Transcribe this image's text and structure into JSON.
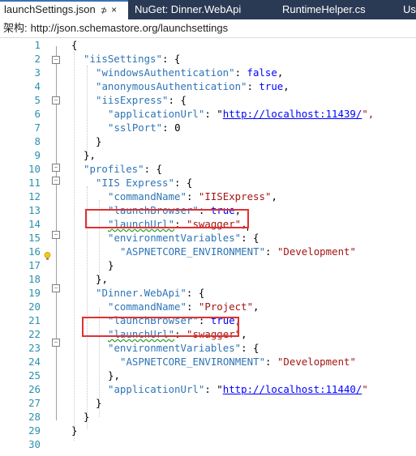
{
  "tabs": [
    {
      "label": "launchSettings.json",
      "pin": "⊅",
      "close": "×",
      "active": true
    },
    {
      "label": "NuGet: Dinner.WebApi",
      "active": false
    },
    {
      "label": "RuntimeHelper.cs",
      "active": false
    },
    {
      "label": "Us",
      "active": false
    }
  ],
  "schema": {
    "label": "架构:",
    "url": "http://json.schemastore.org/launchsettings"
  },
  "line_numbers": [
    "1",
    "2",
    "3",
    "4",
    "5",
    "6",
    "7",
    "8",
    "9",
    "10",
    "11",
    "12",
    "13",
    "14",
    "15",
    "16",
    "17",
    "18",
    "19",
    "20",
    "21",
    "22",
    "23",
    "24",
    "25",
    "26",
    "27",
    "28",
    "29",
    "30"
  ],
  "code": {
    "l1": "{",
    "l2_k": "\"iisSettings\"",
    "l2_p": ": {",
    "l3_k": "\"windowsAuthentication\"",
    "l3_p": ": ",
    "l3_v": "false",
    "l3_e": ",",
    "l4_k": "\"anonymousAuthentication\"",
    "l4_p": ": ",
    "l4_v": "true",
    "l4_e": ",",
    "l5_k": "\"iisExpress\"",
    "l5_p": ": {",
    "l6_k": "\"applicationUrl\"",
    "l6_p": ": \"",
    "l6_v": "http://localhost:11439/",
    "l6_e": "\",",
    "l7_k": "\"sslPort\"",
    "l7_p": ": ",
    "l7_v": "0",
    "l8": "}",
    "l9": "},",
    "l10_k": "\"profiles\"",
    "l10_p": ": {",
    "l11_k": "\"IIS Express\"",
    "l11_p": ": {",
    "l12_k": "\"commandName\"",
    "l12_p": ": ",
    "l12_v": "\"IISExpress\"",
    "l12_e": ",",
    "l13_k": "\"launchBrowser\"",
    "l13_p": ": ",
    "l13_v": "true",
    "l13_e": ",",
    "l14_k": "\"launchUrl\"",
    "l14_p": ": ",
    "l14_v": "\"swagger\"",
    "l14_e": ",",
    "l15_k": "\"environmentVariables\"",
    "l15_p": ": {",
    "l16_k": "\"ASPNETCORE_ENVIRONMENT\"",
    "l16_p": ": ",
    "l16_v": "\"Development\"",
    "l17": "}",
    "l18": "},",
    "l19_k": "\"Dinner.WebApi\"",
    "l19_p": ": {",
    "l20_k": "\"commandName\"",
    "l20_p": ": ",
    "l20_v": "\"Project\"",
    "l20_e": ",",
    "l21_k": "\"launchBrowser\"",
    "l21_p": ": ",
    "l21_v": "true",
    "l21_e": ",",
    "l22_k": "\"launchUrl\"",
    "l22_p": ": ",
    "l22_v": "\"swagger\"",
    "l22_e": ",",
    "l23_k": "\"environmentVariables\"",
    "l23_p": ": {",
    "l24_k": "\"ASPNETCORE_ENVIRONMENT\"",
    "l24_p": ": ",
    "l24_v": "\"Development\"",
    "l25": "},",
    "l26_k": "\"applicationUrl\"",
    "l26_p": ": \"",
    "l26_v": "http://localhost:11440/",
    "l26_e": "\"",
    "l27": "}",
    "l28": "}",
    "l29": "}",
    "l30": ""
  },
  "colors": {
    "tabbar": "#2b3a54",
    "key": "#2e75b6",
    "string": "#a31515",
    "literal": "#0000ff",
    "linenumber": "#2b91af",
    "highlight_box": "#e03131"
  },
  "icons": {
    "lightbulb": "lightbulb-icon"
  }
}
